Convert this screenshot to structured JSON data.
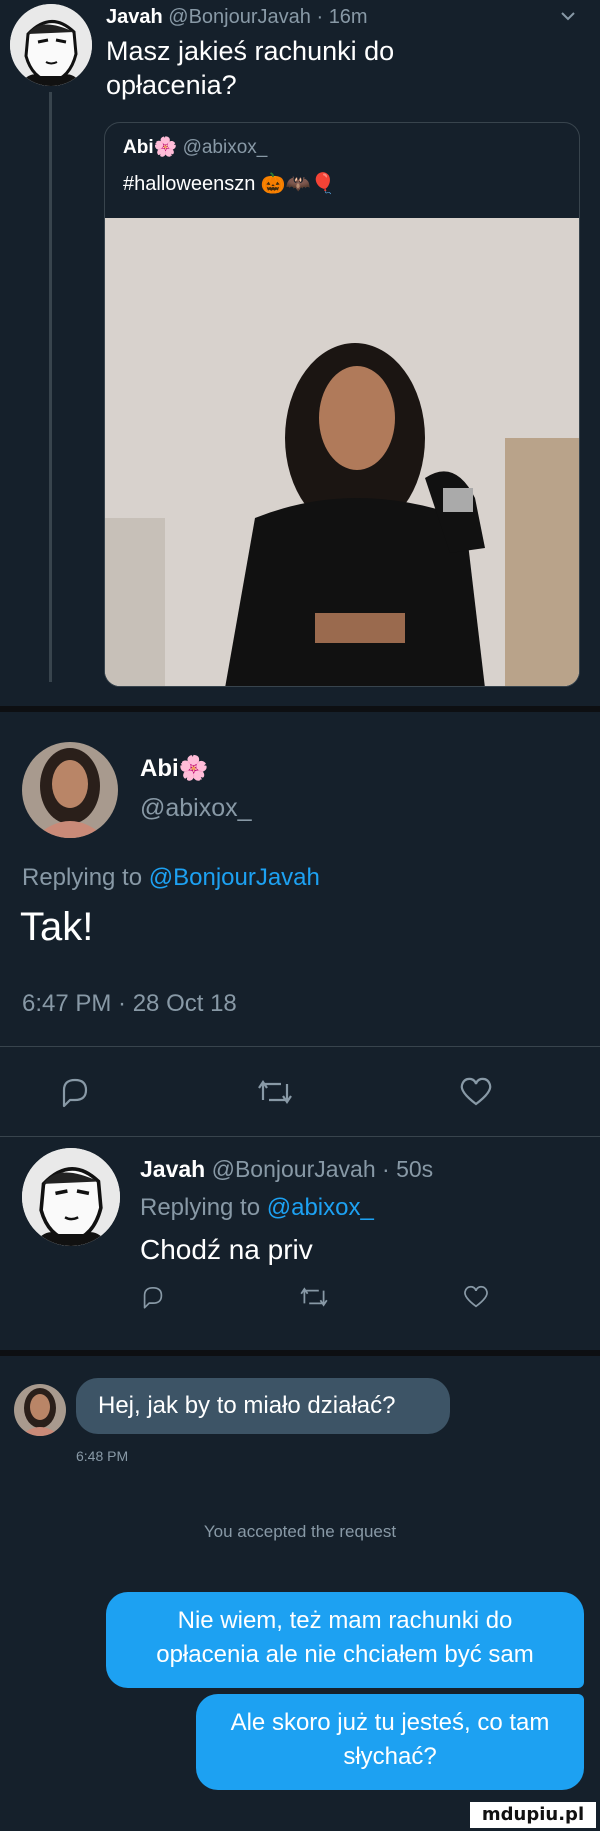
{
  "panel1": {
    "author_name": "Javah",
    "author_handle": "@BonjourJavah",
    "time_sep": "·",
    "time": "16m",
    "tweet_text": "Masz jakieś rachunki do opłacenia?",
    "quoted": {
      "author_name": "Abi",
      "author_emoji": "🌸",
      "author_handle": "@abixox_",
      "text": "#halloweenszn",
      "text_emojis": "🎃🦇🎈"
    }
  },
  "panel2": {
    "author_name": "Abi",
    "author_emoji": "🌸",
    "author_handle": "@abixox_",
    "replying_prefix": "Replying to",
    "replying_handle": "@BonjourJavah",
    "tweet_text": "Tak!",
    "timestamp": "6:47 PM · 28 Oct 18",
    "reply": {
      "author_name": "Javah",
      "author_handle": "@BonjourJavah",
      "time_sep": "·",
      "time": "50s",
      "replying_prefix": "Replying to",
      "replying_handle": "@abixox_",
      "text": "Chodź na priv"
    }
  },
  "panel3": {
    "incoming_message": "Hej, jak by to miało działać?",
    "incoming_time": "6:48 PM",
    "system_notice": "You accepted the request",
    "outgoing_1": "Nie wiem, też mam rachunki do opłacenia ale nie chciałem być sam",
    "outgoing_2": "Ale skoro już tu jesteś, co tam słychać?"
  },
  "watermark": "mdupiu.pl",
  "colors": {
    "background": "#15202b",
    "link": "#1da1f2",
    "muted": "#8899a6",
    "incoming_bubble": "#3d5466",
    "outgoing_bubble": "#1da1f2"
  }
}
